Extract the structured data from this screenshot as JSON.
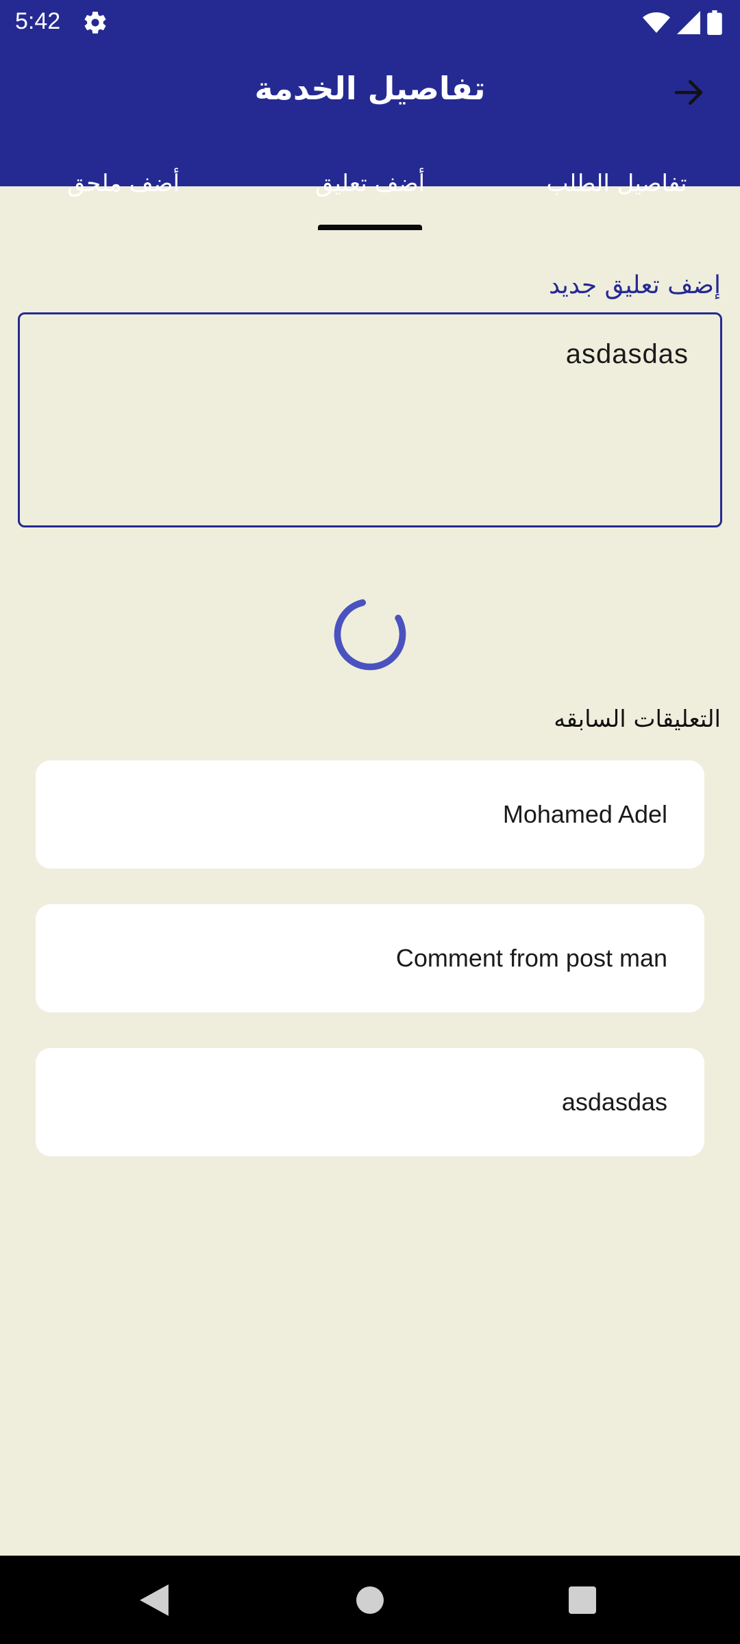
{
  "status_bar": {
    "time": "5:42"
  },
  "app_bar": {
    "title": "تفاصيل الخدمة"
  },
  "tabs": [
    {
      "label": "تفاصيل الطلب",
      "selected": false
    },
    {
      "label": "أضف تعليق",
      "selected": true
    },
    {
      "label": "أضف ملحق",
      "selected": false
    }
  ],
  "comment_form": {
    "label": "إضف تعليق جديد",
    "value": "asdasdas"
  },
  "previous_comments": {
    "title": "التعليقات السابقه",
    "items": [
      "Mohamed Adel",
      "Comment from post man",
      "asdasdas"
    ]
  },
  "colors": {
    "primary": "#252a92",
    "background": "#efeedd",
    "spinner": "#4a52c0",
    "card": "#ffffff"
  }
}
